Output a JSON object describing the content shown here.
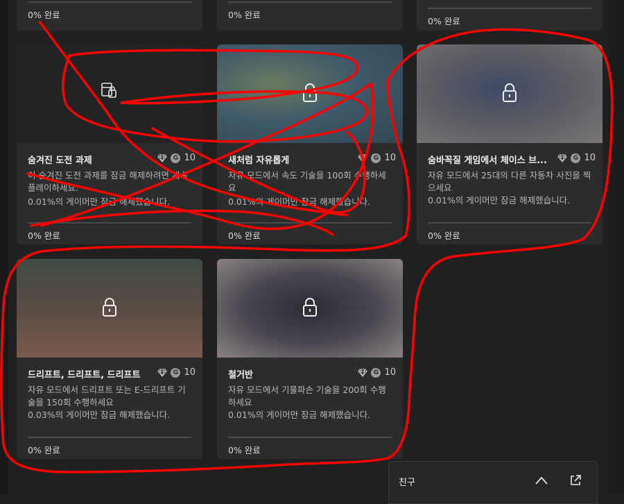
{
  "top_cards": [
    {
      "progress": "0% 완료"
    },
    {
      "progress": "0% 완료"
    },
    {
      "progress": "0% 완료"
    }
  ],
  "cards": [
    {
      "title": "숨겨진 도전 과제",
      "reward": "10",
      "description": "이 숨겨진 도전 과제를 잠금 해제하려면 계속 플레이하세요.",
      "rarity": "0.01%의 게이머만 잠금 해제했습니다.",
      "progress": "0% 완료",
      "image": "hidden",
      "icon": "hidden-achievement-icon"
    },
    {
      "title": "새처럼 자유롭게",
      "reward": "10",
      "description": "자유 모드에서 속도 기술을 100회 수행하세요",
      "rarity": "0.01%의 게이머만 잠금 해제했습니다.",
      "progress": "0% 완료",
      "image": "blur-green",
      "icon": "lock-icon"
    },
    {
      "title": "숨바꼭질 게임에서 체이스 브...",
      "reward": "10",
      "description": "자유 모드에서 25대의 다른 자동차 사진을 찍으세요",
      "rarity": "0.01%의 게이머만 잠금 해제했습니다.",
      "progress": "0% 완료",
      "image": "blur-grey",
      "icon": "lock-icon"
    },
    {
      "title": "드리프트, 드리프트, 드리프트",
      "reward": "10",
      "description": "자유 모드에서 드리프트 또는 E-드리프트 기술을 150회 수행하세요",
      "rarity": "0.03%의 게이머만 잠금 해제했습니다.",
      "progress": "0% 완료",
      "image": "blur-red",
      "icon": "lock-icon"
    },
    {
      "title": "철거반",
      "reward": "10",
      "description": "자유 모드에서 기물파손 기술을 200회 수행하세요",
      "rarity": "0.01%의 게이머만 잠금 해제했습니다.",
      "progress": "0% 완료",
      "image": "blur-dark",
      "icon": "lock-icon"
    }
  ],
  "friends_panel": {
    "label": "친구"
  },
  "colors": {
    "background": "#202020",
    "card": "#2c2c2c",
    "annotation": "#ff0000"
  }
}
